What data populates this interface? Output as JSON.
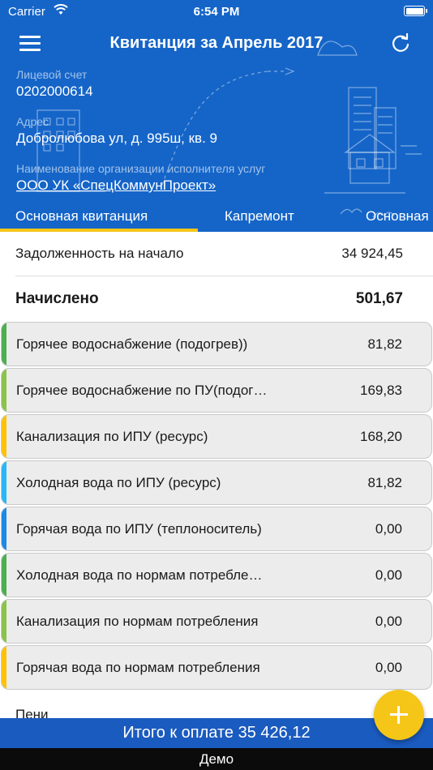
{
  "status_bar": {
    "carrier": "Carrier",
    "time": "6:54 PM"
  },
  "nav": {
    "title": "Квитанция за Апрель 2017"
  },
  "account": {
    "label": "Лицевой счет",
    "value": "0202000614"
  },
  "address": {
    "label": "Адрес",
    "value": "Добролюбова ул, д. 995ш, кв. 9"
  },
  "provider": {
    "label": "Наименование организации исполнителя услуг",
    "value": "ООО УК «СпецКоммунПроект»"
  },
  "tabs": [
    {
      "label": "Основная квитанция",
      "active": true
    },
    {
      "label": "Капремонт",
      "active": false
    },
    {
      "label": "Основная",
      "active": false
    }
  ],
  "summary": {
    "debt_label": "Задолженность на начало",
    "debt_value": "34 924,45",
    "charged_label": "Начислено",
    "charged_value": "501,67"
  },
  "charges": [
    {
      "name": "Горячее водоснабжение (подогрев))",
      "amount": "81,82",
      "color": "#4caf50"
    },
    {
      "name": "Горячее водоснабжение по ПУ(подогрев)",
      "amount": "169,83",
      "color": "#8bc34a"
    },
    {
      "name": "Канализация по ИПУ (ресурс)",
      "amount": "168,20",
      "color": "#ffc107"
    },
    {
      "name": "Холодная вода по ИПУ (ресурс)",
      "amount": "81,82",
      "color": "#29b6f6"
    },
    {
      "name": "Горячая вода по ИПУ (теплоноситель)",
      "amount": "0,00",
      "color": "#1e88e5"
    },
    {
      "name": "Холодная вода по нормам потребления",
      "amount": "0,00",
      "color": "#4caf50"
    },
    {
      "name": "Канализация по нормам потребления",
      "amount": "0,00",
      "color": "#8bc34a"
    },
    {
      "name": "Горячая вода по нормам потребления",
      "amount": "0,00",
      "color": "#ffc107"
    }
  ],
  "penalty": {
    "label": "Пени"
  },
  "total": {
    "text": "Итого к оплате 35 426,12"
  },
  "footer": {
    "demo": "Демо"
  },
  "colors": {
    "header": "#1565c8",
    "tab_indicator": "#f5c518",
    "fab": "#f5c518",
    "total_bar": "#1a5bbf"
  }
}
